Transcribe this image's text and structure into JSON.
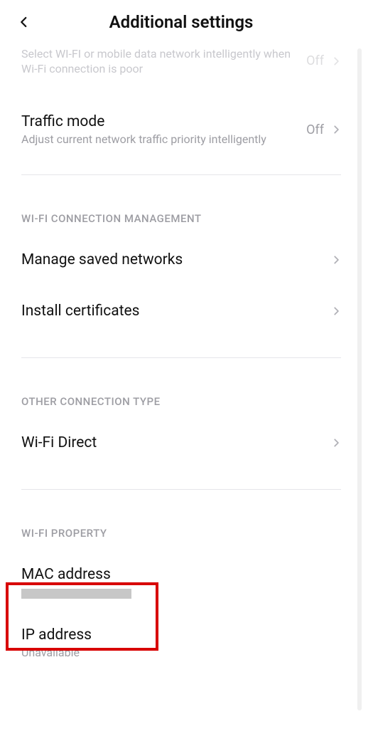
{
  "header": {
    "title": "Additional settings"
  },
  "partial": {
    "title_cut": "Select WI-FI or mobile data network intelligently when Wi-Fi connection is poor",
    "value": "Off"
  },
  "traffic": {
    "title": "Traffic mode",
    "sub": "Adjust current network traffic priority intelligently",
    "value": "Off"
  },
  "sections": {
    "conn_mgmt": "WI-FI CONNECTION MANAGEMENT",
    "other_conn": "OTHER CONNECTION TYPE",
    "wifi_prop": "WI-FI PROPERTY"
  },
  "manage_networks": {
    "title": "Manage saved networks"
  },
  "install_certs": {
    "title": "Install certificates"
  },
  "wifi_direct": {
    "title": "Wi-Fi Direct"
  },
  "mac": {
    "title": "MAC address"
  },
  "ip": {
    "title": "IP address",
    "value": "Unavailable"
  }
}
